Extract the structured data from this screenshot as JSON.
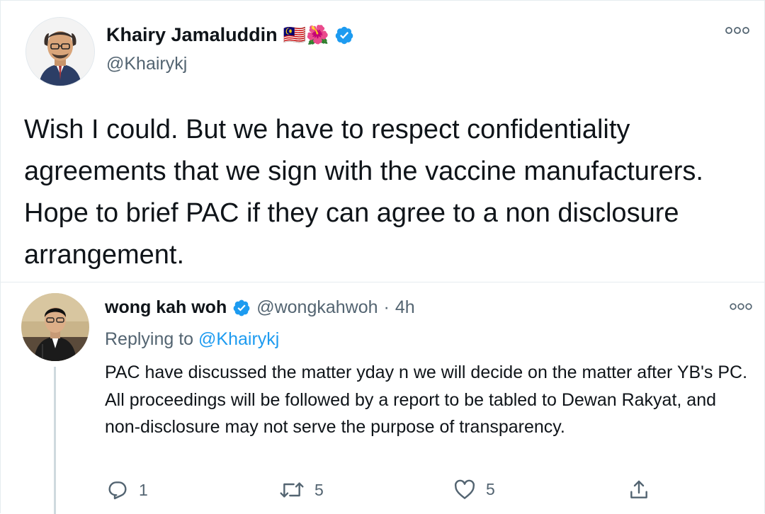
{
  "main_tweet": {
    "author_name": "Khairy Jamaluddin",
    "handle": "@Khairykj",
    "name_emojis": "🇲🇾🌺",
    "text": "Wish I could. But we have to respect confidentiality agreements that we sign with the vaccine manufacturers. Hope to brief PAC if they can agree to a non disclosure arrangement."
  },
  "reply_tweet": {
    "author_name": "wong kah woh",
    "handle": "@wongkahwoh",
    "separator": "·",
    "time": "4h",
    "replying_prefix": "Replying to",
    "replying_to": "@Khairykj",
    "text": "PAC have discussed the matter yday n we will decide on the matter after YB's PC. All proceedings will be followed by a report to be tabled to Dewan Rakyat, and non-disclosure may not serve the purpose of transparency.",
    "actions": {
      "reply_count": "1",
      "retweet_count": "5",
      "like_count": "5"
    }
  },
  "colors": {
    "accent": "#1d9bf0",
    "muted": "#536471",
    "text": "#0f1419"
  },
  "icons": [
    "verified-badge-icon",
    "more-icon",
    "reply-icon",
    "retweet-icon",
    "like-icon",
    "share-icon"
  ]
}
